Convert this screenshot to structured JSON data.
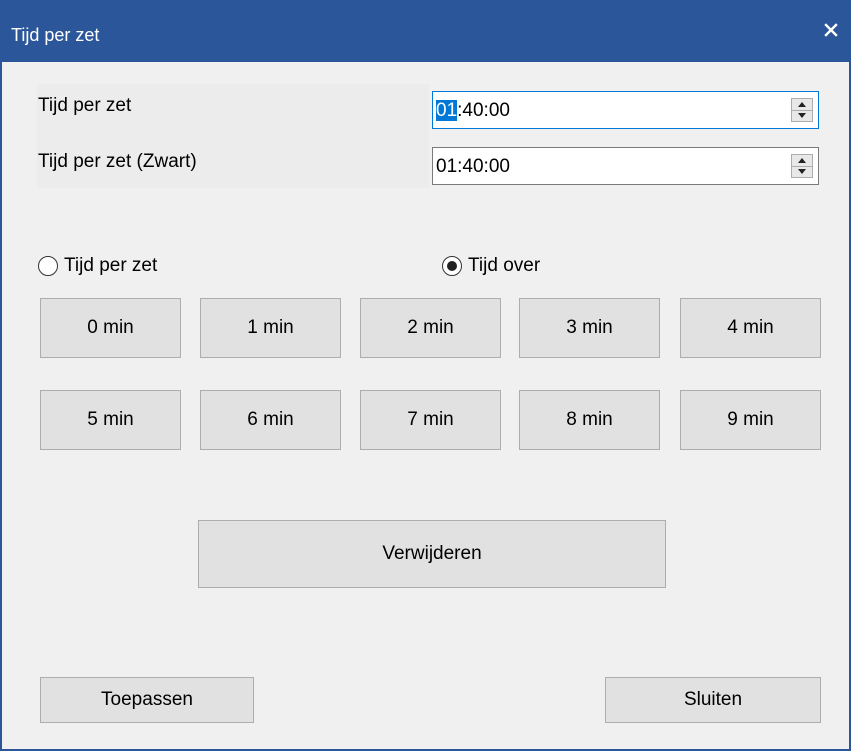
{
  "window": {
    "title": "Tijd per zet",
    "close_icon": "close-icon",
    "accent_color": "#2b579a"
  },
  "fields": {
    "time_per_move_label": "Tijd per zet",
    "time_per_move_value_selected": "01",
    "time_per_move_value_rest": ":40:00",
    "time_per_move_black_label": "Tijd per zet (Zwart)",
    "time_per_move_black_value": "01:40:00"
  },
  "mode": {
    "option_time_per_move": "Tijd per zet",
    "option_time_left": "Tijd over",
    "selected": "Tijd over"
  },
  "presets": [
    "0 min",
    "1 min",
    "2 min",
    "3 min",
    "4 min",
    "5 min",
    "6 min",
    "7 min",
    "8 min",
    "9 min"
  ],
  "actions": {
    "remove_label": "Verwijderen",
    "apply_label": "Toepassen",
    "close_label": "Sluiten"
  }
}
